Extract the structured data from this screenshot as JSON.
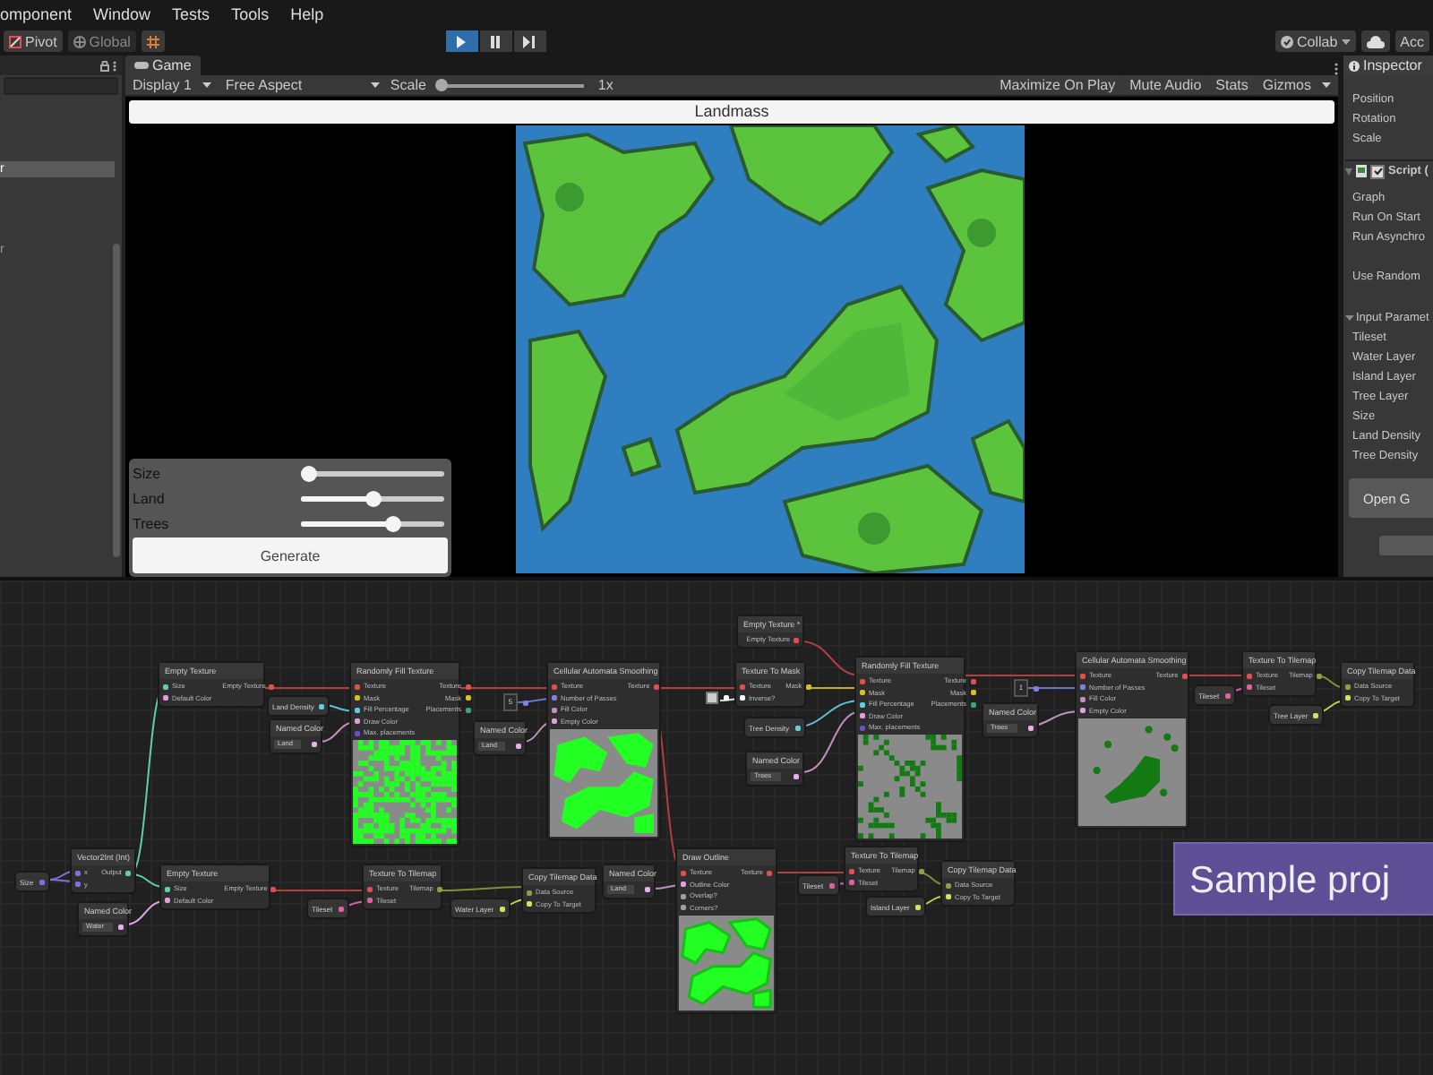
{
  "menu_bar": {
    "items": [
      "omponent",
      "Window",
      "Tests",
      "Tools",
      "Help"
    ]
  },
  "toolbar": {
    "pivot": "Pivot",
    "global": "Global",
    "playback": [
      {
        "kind": "play",
        "selected": true
      },
      {
        "kind": "pause",
        "selected": false
      },
      {
        "kind": "step",
        "selected": false
      }
    ],
    "collab": "Collab",
    "account": "Acc"
  },
  "hierarchy": {
    "rows": [
      {
        "label": "r",
        "selected": true
      },
      {
        "label": "r",
        "selected": false
      }
    ]
  },
  "game": {
    "tab": "Game",
    "display": "Display 1",
    "aspect": "Free Aspect",
    "scale_label": "Scale",
    "scale": {
      "level": 0
    },
    "scale_reading": "1x",
    "toggles": [
      "Maximize On Play",
      "Mute Audio",
      "Stats"
    ],
    "gizmos": "Gizmos",
    "title": "Landmass",
    "controls": [
      {
        "label": "Size",
        "level": 0
      },
      {
        "label": "Land",
        "level": 0.5
      },
      {
        "label": "Trees",
        "level": 0.65
      }
    ],
    "button": "Generate"
  },
  "inspector": {
    "tab": "Inspector",
    "transform": [
      "Position",
      "Rotation",
      "Scale"
    ],
    "component": {
      "title": "Script (",
      "enabled": true
    },
    "fields": [
      "Graph",
      "Run On Start",
      "Run Asynchro"
    ],
    "extra_field": "Use Random",
    "section": {
      "title": "Input Paramet",
      "expanded": true
    },
    "params": [
      "Tileset",
      "Water Layer",
      "Island Layer",
      "Tree Layer",
      "Size",
      "Land Density",
      "Tree Density"
    ],
    "button": "Open G"
  },
  "graph": {
    "nodes": [
      {
        "kind": "node",
        "title": "Empty Texture",
        "inputs": [
          {
            "label": "Size",
            "color": "#5fd0a8"
          },
          {
            "label": "Default Color",
            "color": "#e0a0e0"
          }
        ],
        "outputs": [
          {
            "label": "Empty Texture",
            "color": "#e05050"
          }
        ]
      },
      {
        "kind": "property",
        "label": "Land Density",
        "color": "#60d0e0"
      },
      {
        "kind": "color",
        "title": "Named Color",
        "value": "Land",
        "color": "#e8b0e8"
      },
      {
        "kind": "node",
        "title": "Randomly Fill Texture",
        "inputs": [
          {
            "label": "Texture",
            "color": "#e05050"
          },
          {
            "label": "Mask",
            "color": "#d8c020"
          },
          {
            "label": "Fill Percentage",
            "color": "#60d0e0"
          },
          {
            "label": "Draw Color",
            "color": "#e0a0e0"
          },
          {
            "label": "Max. placements",
            "color": "#7050c0"
          }
        ],
        "outputs": [
          {
            "label": "Texture",
            "color": "#e05050"
          },
          {
            "label": "Mask",
            "color": "#d8c020"
          },
          {
            "label": "Placements",
            "color": "#40a080"
          }
        ],
        "preview": {
          "kind": "noise-light"
        }
      },
      {
        "kind": "property",
        "label": "Size",
        "color": "#8070e0"
      },
      {
        "kind": "node",
        "title": "Vector2Int (Int)",
        "inputs": [
          {
            "label": "x",
            "color": "#8070e0"
          },
          {
            "label": "y",
            "color": "#8070e0"
          }
        ],
        "outputs": [
          {
            "label": "Output",
            "color": "#5fd0a8"
          }
        ]
      },
      {
        "kind": "color",
        "title": "Named Color",
        "value": "Water",
        "color": "#e8b0e8"
      },
      {
        "kind": "node",
        "title": "Empty Texture",
        "inputs": [
          {
            "label": "Size",
            "color": "#5fd0a8"
          },
          {
            "label": "Default Color",
            "color": "#e0a0e0"
          }
        ],
        "outputs": [
          {
            "label": "Empty Texture",
            "color": "#e05050"
          }
        ]
      },
      {
        "kind": "property",
        "label": "Tileset",
        "color": "#e060a0"
      },
      {
        "kind": "node",
        "title": "Texture To Tilemap",
        "inputs": [
          {
            "label": "Texture",
            "color": "#e05050"
          },
          {
            "label": "Tileset",
            "color": "#e060a0"
          }
        ],
        "outputs": [
          {
            "label": "Tilemap",
            "color": "#90a040"
          }
        ]
      },
      {
        "kind": "property",
        "label": "Water Layer",
        "color": "#d8e060"
      },
      {
        "kind": "node",
        "title": "Copy Tilemap Data",
        "inputs": [
          {
            "label": "Data Source",
            "color": "#90a040"
          },
          {
            "label": "Copy To Target",
            "color": "#d8e060"
          }
        ]
      },
      {
        "kind": "int",
        "value": "5",
        "color": "#8080e0"
      },
      {
        "kind": "color",
        "title": "Named Color",
        "value": "Land",
        "color": "#e8b0e8"
      },
      {
        "kind": "node",
        "title": "Cellular Automata Smoothing",
        "inputs": [
          {
            "label": "Texture",
            "color": "#e05050"
          },
          {
            "label": "Number of Passes",
            "color": "#8080e0"
          },
          {
            "label": "Fill Color",
            "color": "#c090c0"
          },
          {
            "label": "Empty Color",
            "color": "#e0a0e0"
          }
        ],
        "outputs": [
          {
            "label": "Texture",
            "color": "#e05050"
          }
        ],
        "preview": {
          "kind": "blobs-light"
        }
      },
      {
        "kind": "color",
        "title": "Named Color",
        "value": "Land",
        "color": "#e8b0e8"
      },
      {
        "kind": "node",
        "title": "Draw Outline",
        "inputs": [
          {
            "label": "Texture",
            "color": "#e05050"
          },
          {
            "label": "Outline Color",
            "color": "#e0a0e0"
          },
          {
            "label": "Overlap?",
            "color": "#a0a0a0"
          },
          {
            "label": "Corners?",
            "color": "#a0a0a0"
          }
        ],
        "outputs": [
          {
            "label": "Texture",
            "color": "#e05050"
          }
        ],
        "preview": {
          "kind": "outline"
        }
      },
      {
        "kind": "node",
        "title": "Empty Texture *",
        "outputs": [
          {
            "label": "Empty Texture",
            "color": "#e05050"
          }
        ]
      },
      {
        "kind": "toggle",
        "checked": true,
        "color": "#ffffff"
      },
      {
        "kind": "node",
        "title": "Texture To Mask",
        "inputs": [
          {
            "label": "Texture",
            "color": "#e05050"
          },
          {
            "label": "Inverse?",
            "color": "#ffffff"
          }
        ],
        "outputs": [
          {
            "label": "Mask",
            "color": "#d8c020"
          }
        ]
      },
      {
        "kind": "property",
        "label": "Tree Density",
        "color": "#60d0e0"
      },
      {
        "kind": "color",
        "title": "Named Color",
        "value": "Trees",
        "color": "#e8b0e8"
      },
      {
        "kind": "node",
        "title": "Randomly Fill Texture",
        "inputs": [
          {
            "label": "Texture",
            "color": "#e05050"
          },
          {
            "label": "Mask",
            "color": "#d8c020"
          },
          {
            "label": "Fill Percentage",
            "color": "#60d0e0"
          },
          {
            "label": "Draw Color",
            "color": "#e0a0e0"
          },
          {
            "label": "Max. placements",
            "color": "#7050c0"
          }
        ],
        "outputs": [
          {
            "label": "Texture",
            "color": "#e05050"
          },
          {
            "label": "Mask",
            "color": "#d8c020"
          },
          {
            "label": "Placements",
            "color": "#40a080"
          }
        ],
        "preview": {
          "kind": "noise-dark"
        }
      },
      {
        "kind": "int",
        "value": "1",
        "color": "#8080e0"
      },
      {
        "kind": "color",
        "title": "Named Color",
        "value": "Trees",
        "color": "#e8b0e8"
      },
      {
        "kind": "property",
        "label": "Tileset",
        "color": "#e060a0"
      },
      {
        "kind": "node",
        "title": "Texture To Tilemap",
        "inputs": [
          {
            "label": "Texture",
            "color": "#e05050"
          },
          {
            "label": "Tileset",
            "color": "#e060a0"
          }
        ],
        "outputs": [
          {
            "label": "Tilemap",
            "color": "#90a040"
          }
        ]
      },
      {
        "kind": "property",
        "label": "Island Layer",
        "color": "#d8e060"
      },
      {
        "kind": "node",
        "title": "Copy Tilemap Data",
        "inputs": [
          {
            "label": "Data Source",
            "color": "#90a040"
          },
          {
            "label": "Copy To Target",
            "color": "#d8e060"
          }
        ]
      },
      {
        "kind": "node",
        "title": "Cellular Automata Smoothing",
        "inputs": [
          {
            "label": "Texture",
            "color": "#e05050"
          },
          {
            "label": "Number of Passes",
            "color": "#8080e0"
          },
          {
            "label": "Fill Color",
            "color": "#c090c0"
          },
          {
            "label": "Empty Color",
            "color": "#e0a0e0"
          }
        ],
        "outputs": [
          {
            "label": "Texture",
            "color": "#e05050"
          }
        ],
        "preview": {
          "kind": "blob-dark"
        }
      },
      {
        "kind": "property",
        "label": "Tileset",
        "color": "#e060a0"
      },
      {
        "kind": "node",
        "title": "Texture To Tilemap",
        "inputs": [
          {
            "label": "Texture",
            "color": "#e05050"
          },
          {
            "label": "Tileset",
            "color": "#e060a0"
          }
        ],
        "outputs": [
          {
            "label": "Tilemap",
            "color": "#90a040"
          }
        ]
      },
      {
        "kind": "property",
        "label": "Tree Layer",
        "color": "#d8e060"
      },
      {
        "kind": "node",
        "title": "Copy Tilemap Data",
        "inputs": [
          {
            "label": "Data Source",
            "color": "#90a040"
          },
          {
            "label": "Copy To Target",
            "color": "#d8e060"
          }
        ]
      }
    ],
    "banner": "Sample proj"
  }
}
